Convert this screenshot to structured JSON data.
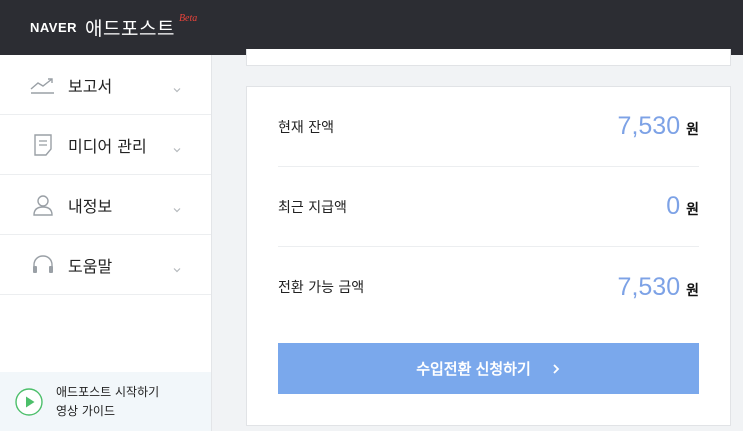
{
  "header": {
    "brand": "NAVER",
    "product": "애드포스트",
    "badge": "Beta"
  },
  "sidebar": {
    "items": [
      {
        "label": "보고서",
        "icon": "trend-chart-icon"
      },
      {
        "label": "미디어 관리",
        "icon": "document-icon"
      },
      {
        "label": "내정보",
        "icon": "person-icon"
      },
      {
        "label": "도움말",
        "icon": "headset-icon"
      }
    ],
    "guide": {
      "line1": "애드포스트 시작하기",
      "line2": "영상 가이드",
      "icon": "play-circle-icon"
    }
  },
  "balance": {
    "rows": [
      {
        "label": "현재 잔액",
        "amount": "7,530",
        "unit": "원"
      },
      {
        "label": "최근 지급액",
        "amount": "0",
        "unit": "원"
      },
      {
        "label": "전환 가능 금액",
        "amount": "7,530",
        "unit": "원"
      }
    ],
    "button": "수입전환 신청하기"
  },
  "colors": {
    "topbar": "#2c2d33",
    "accent": "#7aa8ec",
    "amount": "#7da2e6",
    "beta": "#e8433b"
  }
}
